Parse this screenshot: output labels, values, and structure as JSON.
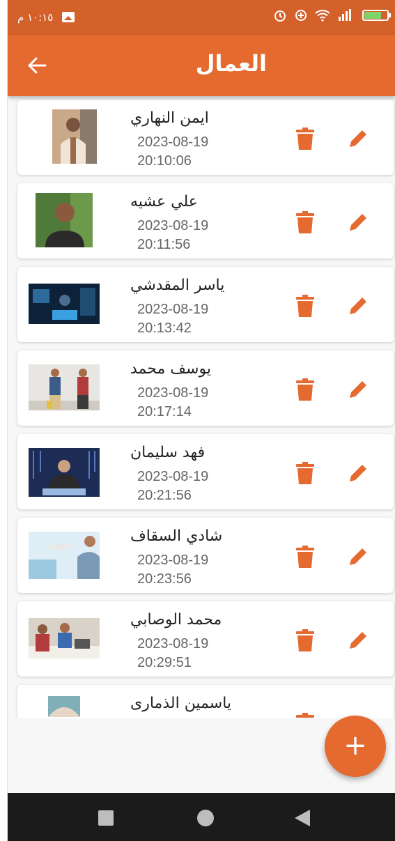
{
  "status_bar": {
    "time": "١٠:١٥ م"
  },
  "app_bar": {
    "title": "العمال",
    "back_icon": "arrow-left-icon"
  },
  "colors": {
    "primary": "#e46a2f",
    "status": "#d4602a"
  },
  "workers": [
    {
      "name": "ايمن النهاري",
      "date": "2023-08-19",
      "time": "20:10:06"
    },
    {
      "name": "علي عشيه",
      "date": "2023-08-19",
      "time": "20:11:56"
    },
    {
      "name": "ياسر المقدشي",
      "date": "2023-08-19",
      "time": "20:13:42"
    },
    {
      "name": "يوسف محمد",
      "date": "2023-08-19",
      "time": "20:17:14"
    },
    {
      "name": "فهد سليمان",
      "date": "2023-08-19",
      "time": "20:21:56"
    },
    {
      "name": "شادي السقاف",
      "date": "2023-08-19",
      "time": "20:23:56"
    },
    {
      "name": "محمد الوصابي",
      "date": "2023-08-19",
      "time": "20:29:51"
    },
    {
      "name": "ياسمين الذمارى",
      "date": "",
      "time": ""
    }
  ],
  "fab": {
    "label": "+"
  }
}
